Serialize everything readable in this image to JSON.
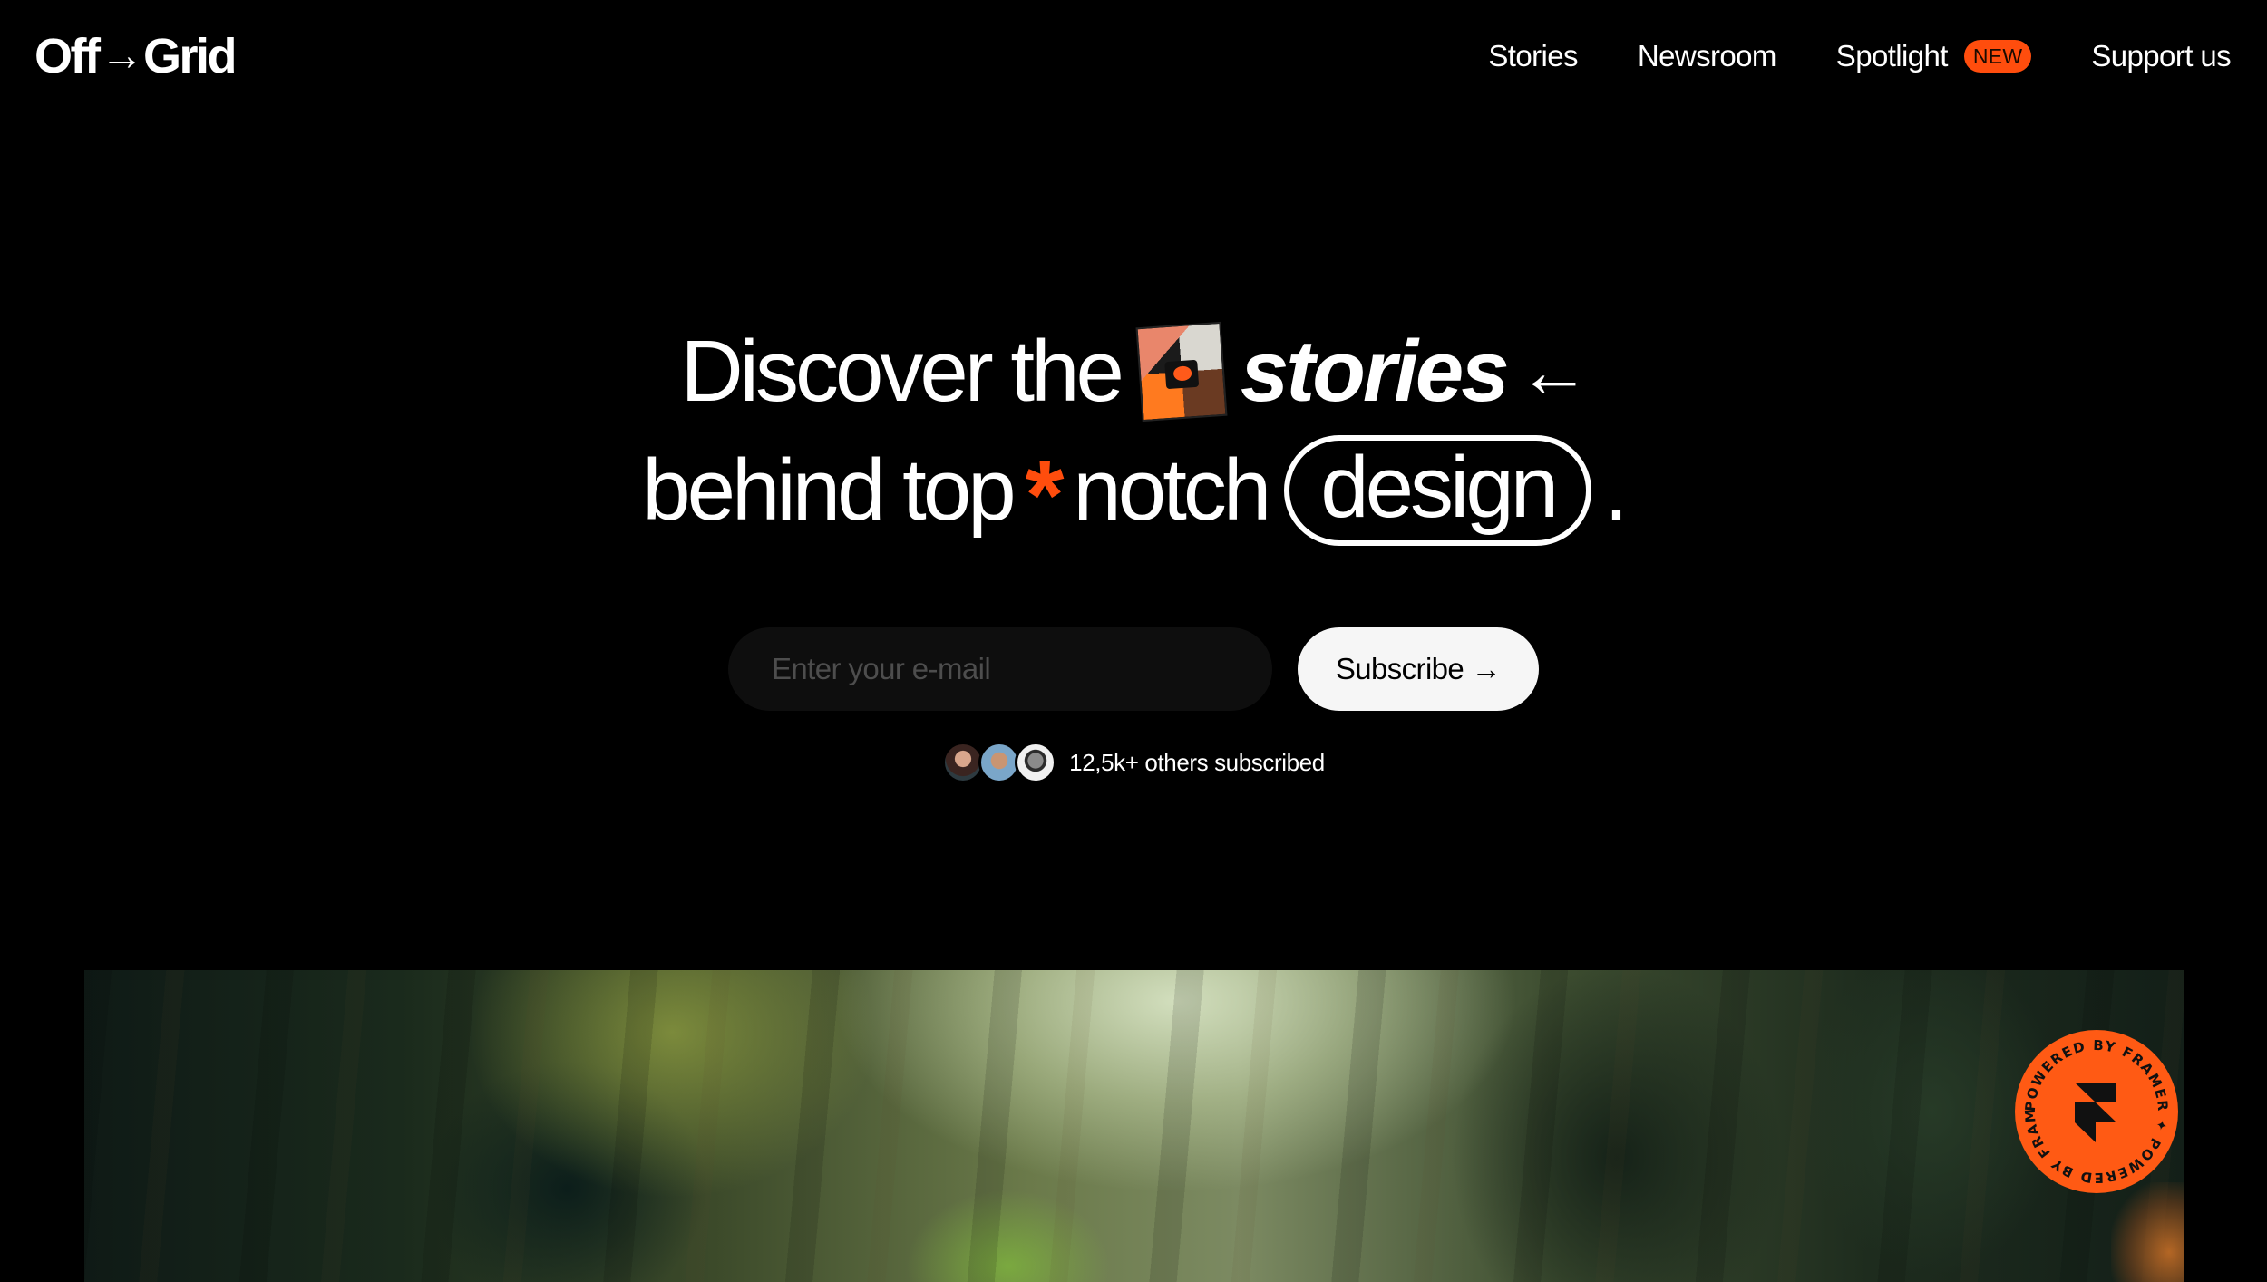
{
  "nav": {
    "logo": {
      "left": "Off",
      "arrow": "→",
      "right": "Grid"
    },
    "links": [
      {
        "label": "Stories"
      },
      {
        "label": "Newsroom"
      },
      {
        "label": "Spotlight",
        "badge": "NEW"
      },
      {
        "label": "Support us"
      }
    ]
  },
  "hero": {
    "line1": {
      "text": "Discover the",
      "italic": "stories",
      "arrow": "←",
      "thumbnail_icon": "collage-thumbnail"
    },
    "line2": {
      "text1": "behind top",
      "asterisk": "*",
      "text2": "notch",
      "pill": "design",
      "end": "."
    }
  },
  "form": {
    "email_placeholder": "Enter your e-mail",
    "email_value": "",
    "subscribe_label": "Subscribe →"
  },
  "social": {
    "text": "12,5k+ others subscribed",
    "avatars": [
      "avatar-woman",
      "avatar-man-sunglasses",
      "avatar-man-glasses"
    ]
  },
  "badge": {
    "ring_text": "POWERED BY FRAMER ✦ POWERED BY FRAMER ✦ ",
    "icon": "framer-logo"
  },
  "colors": {
    "background": "#000000",
    "accent": "#ff4d0d",
    "text": "#ffffff",
    "input_bg": "#0e0e0e",
    "button_bg": "#f6f6f6"
  }
}
